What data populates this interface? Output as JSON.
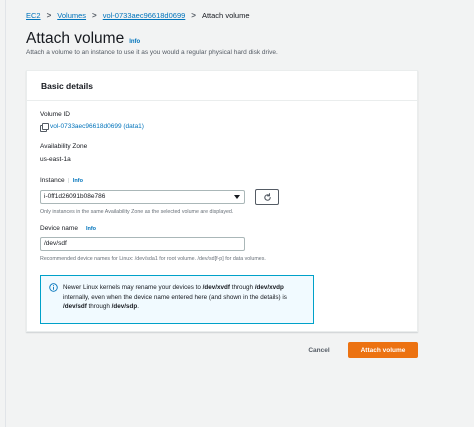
{
  "breadcrumb": {
    "items": [
      "EC2",
      "Volumes",
      "vol-0733aec96618d0699"
    ],
    "current": "Attach volume",
    "separator": ">"
  },
  "header": {
    "title": "Attach volume",
    "info": "Info",
    "subtitle": "Attach a volume to an instance to use it as you would a regular physical hard disk drive."
  },
  "panel": {
    "title": "Basic details",
    "volume_id": {
      "label": "Volume ID",
      "value": "vol-0733aec96618d0699 (data1)"
    },
    "availability_zone": {
      "label": "Availability Zone",
      "value": "us-east-1a"
    },
    "instance": {
      "label": "Instance",
      "info": "Info",
      "selected": "i-0ff1d26091b08e786",
      "hint": "Only instances in the same Availability Zone as the selected volume are displayed."
    },
    "device_name": {
      "label": "Device name",
      "info": "Info",
      "value": "/dev/sdf",
      "hint": "Recommended device names for Linux: /dev/sda1 for root volume. /dev/sd[f-p] for data volumes."
    },
    "alert": {
      "t1": "Newer Linux kernels may rename your devices to ",
      "b1": "/dev/xvdf",
      "t2": " through ",
      "b2": "/dev/xvdp",
      "t3": " internally, even when the device name entered here (and shown in the details) is ",
      "b3": "/dev/sdf",
      "t4": " through ",
      "b4": "/dev/sdp",
      "t5": "."
    }
  },
  "footer": {
    "cancel_label": "Cancel",
    "submit_label": "Attach volume"
  },
  "colors": {
    "accent": "#ec7211",
    "link": "#0073bb",
    "alert_border": "#00a1c9",
    "alert_bg": "#f1faff"
  }
}
